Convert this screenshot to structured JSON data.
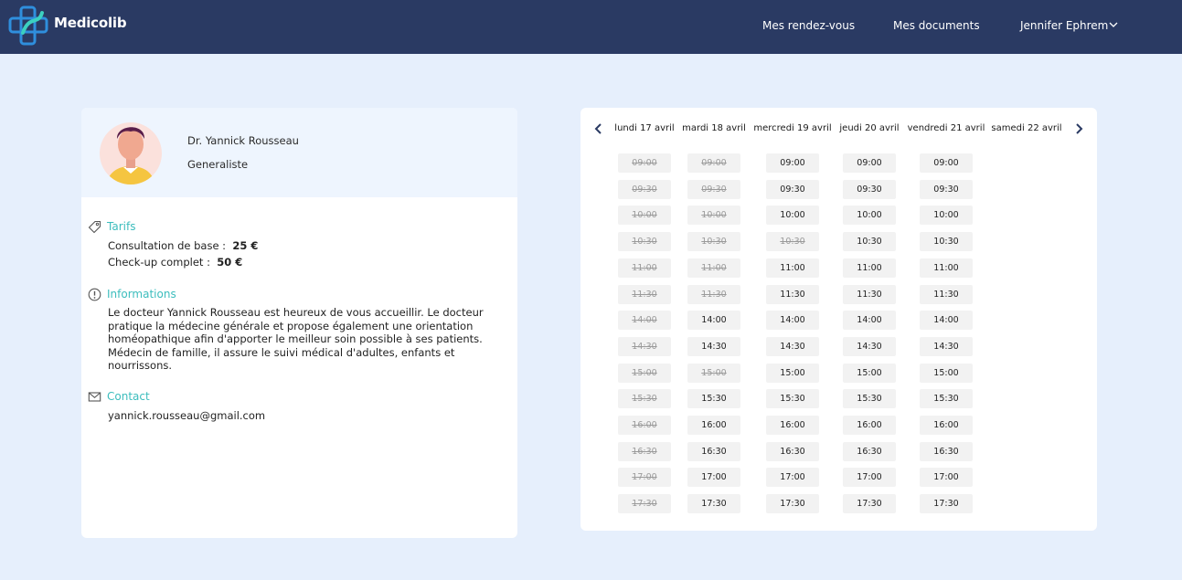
{
  "header": {
    "brand": "Medicolib",
    "nav": [
      "Mes rendez-vous",
      "Mes documents"
    ],
    "user": "Jennifer Ephrem",
    "colors": {
      "bar": "#2a3a63",
      "accent": "#3cbdbd"
    }
  },
  "doctor": {
    "name": "Dr. Yannick Rousseau",
    "specialty": "Generaliste",
    "sections": {
      "tarifs": {
        "title": "Tarifs",
        "icon": "tag-icon",
        "items": [
          {
            "label": "Consultation de base :",
            "price": "25 €"
          },
          {
            "label": "Check-up complet :",
            "price": "50 €"
          }
        ]
      },
      "informations": {
        "title": "Informations",
        "icon": "info-icon",
        "text": "Le docteur Yannick Rousseau est heureux de vous accueillir. Le docteur pratique la médecine générale et propose également une orientation homéopathique afin d'apporter le meilleur soin possible à ses patients. Médecin de famille, il assure le suivi médical d'adultes, enfants et nourrissons."
      },
      "contact": {
        "title": "Contact",
        "icon": "mail-icon",
        "email": "yannick.rousseau@gmail.com"
      }
    }
  },
  "calendar": {
    "prev_icon": "chevron-left-icon",
    "next_icon": "chevron-right-icon",
    "days": [
      {
        "label": "lundi 17 avril",
        "times": [
          "09:00",
          "09:30",
          "10:00",
          "10:30",
          "11:00",
          "11:30",
          "14:00",
          "14:30",
          "15:00",
          "15:30",
          "16:00",
          "16:30",
          "17:00",
          "17:30"
        ],
        "disabled": [
          "09:00",
          "09:30",
          "10:00",
          "10:30",
          "11:00",
          "11:30",
          "14:00",
          "14:30",
          "15:00",
          "15:30",
          "16:00",
          "16:30",
          "17:00",
          "17:30"
        ]
      },
      {
        "label": "mardi 18 avril",
        "times": [
          "09:00",
          "09:30",
          "10:00",
          "10:30",
          "11:00",
          "11:30",
          "14:00",
          "14:30",
          "15:00",
          "15:30",
          "16:00",
          "16:30",
          "17:00",
          "17:30"
        ],
        "disabled": [
          "09:00",
          "09:30",
          "10:00",
          "10:30",
          "11:00",
          "11:30",
          "15:00"
        ]
      },
      {
        "label": "mercredi 19 avril",
        "times": [
          "09:00",
          "09:30",
          "10:00",
          "10:30",
          "11:00",
          "11:30",
          "14:00",
          "14:30",
          "15:00",
          "15:30",
          "16:00",
          "16:30",
          "17:00",
          "17:30"
        ],
        "disabled": [
          "10:30"
        ]
      },
      {
        "label": "jeudi 20 avril",
        "times": [
          "09:00",
          "09:30",
          "10:00",
          "10:30",
          "11:00",
          "11:30",
          "14:00",
          "14:30",
          "15:00",
          "15:30",
          "16:00",
          "16:30",
          "17:00",
          "17:30"
        ],
        "disabled": []
      },
      {
        "label": "vendredi 21 avril",
        "times": [
          "09:00",
          "09:30",
          "10:00",
          "10:30",
          "11:00",
          "11:30",
          "14:00",
          "14:30",
          "15:00",
          "15:30",
          "16:00",
          "16:30",
          "17:00",
          "17:30"
        ],
        "disabled": []
      },
      {
        "label": "samedi 22 avril",
        "times": [],
        "disabled": []
      }
    ]
  }
}
